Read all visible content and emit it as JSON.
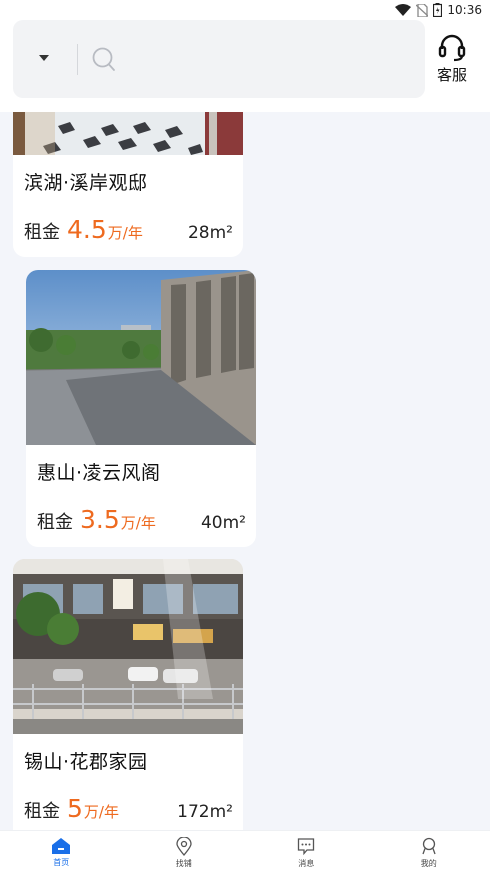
{
  "status_bar": {
    "time": "10:36"
  },
  "header": {
    "search_placeholder": "",
    "service_label": "客服"
  },
  "listings": [
    {
      "title": "滨湖·溪岸观邸",
      "price_label": "租金",
      "price_value": "4.5",
      "price_unit": "万/年",
      "area": "28m²"
    },
    {
      "title": "惠山·凌云风阁",
      "price_label": "租金",
      "price_value": "3.5",
      "price_unit": "万/年",
      "area": "40m²"
    },
    {
      "title": "锡山·花郡家园",
      "price_label": "租金",
      "price_value": "5",
      "price_unit": "万/年",
      "area": "172m²"
    }
  ],
  "bottom_nav": {
    "items": [
      {
        "label": "首页",
        "icon": "home-icon",
        "active": true
      },
      {
        "label": "找铺",
        "icon": "location-pin-icon",
        "active": false
      },
      {
        "label": "消息",
        "icon": "message-icon",
        "active": false
      },
      {
        "label": "我的",
        "icon": "user-icon",
        "active": false
      }
    ]
  },
  "colors": {
    "accent": "#1a6fe8",
    "price": "#ee6a1f",
    "background": "#f3f5fa"
  }
}
